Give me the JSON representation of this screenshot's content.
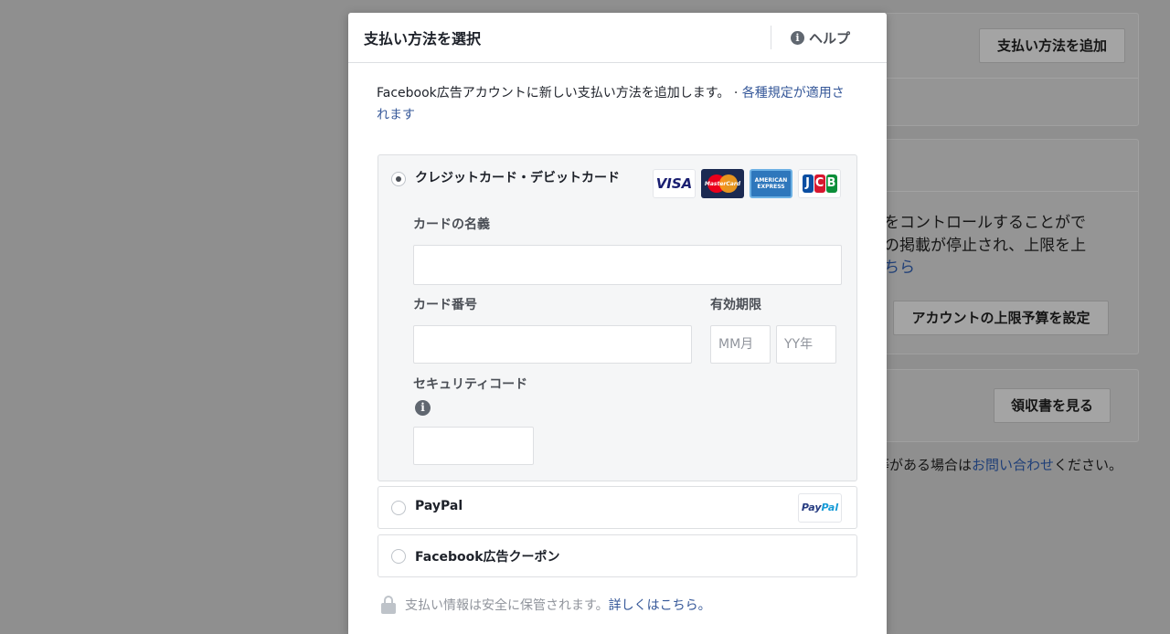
{
  "background": {
    "add_payment_button": "支払い方法を追加",
    "limit_text_line1": "をコントロールすることがで",
    "limit_text_line2": "の掲載が停止され、上限を上",
    "limit_text_link": "ちら",
    "set_limit_button": "アカウントの上限予算を設定",
    "receipt_button": "領収書を見る",
    "contact_prefix": "等がある場合は",
    "contact_link": "お問い合わせ",
    "contact_suffix": "ください。"
  },
  "modal": {
    "title": "支払い方法を選択",
    "help_label": "ヘルプ",
    "intro_text": "Facebook広告アカウントに新しい支払い方法を追加します。 · ",
    "intro_link": "各種規定が適用されます",
    "options": {
      "card": {
        "label": "クレジットカード・デビットカード",
        "brands": {
          "visa": "VISA",
          "mastercard": "MasterCard",
          "amex": "AMERICAN EXPRESS",
          "jcb_j": "J",
          "jcb_c": "C",
          "jcb_b": "B"
        },
        "name_label": "カードの名義",
        "number_label": "カード番号",
        "expiry_label": "有効期限",
        "month_placeholder": "MM月",
        "year_placeholder": "YY年",
        "security_label": "セキュリティコード"
      },
      "paypal": {
        "label": "PayPal",
        "logo_pay": "Pay",
        "logo_pal": "Pal"
      },
      "coupon": {
        "label": "Facebook広告クーポン"
      }
    },
    "footer_text": "支払い情報は安全に保管されます。",
    "footer_link": "詳しくはこちら。"
  },
  "icons": {
    "info_glyph": "i"
  }
}
